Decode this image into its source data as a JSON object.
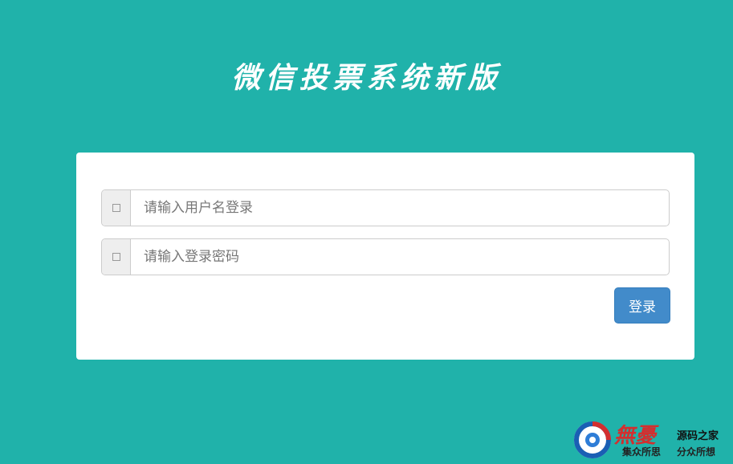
{
  "header": {
    "title": "微信投票系统新版"
  },
  "login": {
    "username_placeholder": "请输入用户名登录",
    "password_placeholder": "请输入登录密码",
    "submit_label": "登录"
  },
  "watermark": {
    "brand": "無憂",
    "line1": "源码之家",
    "line2_left": "集众所思",
    "line2_right": "分众所想"
  },
  "colors": {
    "background": "#20b2aa",
    "button": "#428bca",
    "panel": "#ffffff"
  },
  "icons": {
    "username": "user-icon",
    "password": "lock-icon"
  }
}
